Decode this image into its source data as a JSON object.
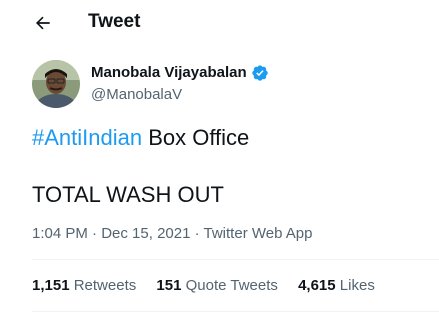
{
  "colors": {
    "accent": "#1d9bf0",
    "muted": "#536471",
    "text": "#0f1419"
  },
  "header": {
    "back_icon": "arrow-left-icon",
    "title": "Tweet"
  },
  "author": {
    "name": "Manobala Vijayabalan",
    "handle": "@ManobalaV",
    "verified_icon": "verified-badge-icon"
  },
  "tweet": {
    "hashtag": "#AntiIndian",
    "line1_rest": " Box Office",
    "line2": "TOTAL WASH OUT"
  },
  "meta": {
    "time": "1:04 PM",
    "sep1": " · ",
    "date": "Dec 15, 2021",
    "sep2": " · ",
    "source": "Twitter Web App"
  },
  "stats": {
    "retweets_count": "1,151",
    "retweets_label": "Retweets",
    "quotes_count": "151",
    "quotes_label": "Quote Tweets",
    "likes_count": "4,615",
    "likes_label": "Likes"
  }
}
